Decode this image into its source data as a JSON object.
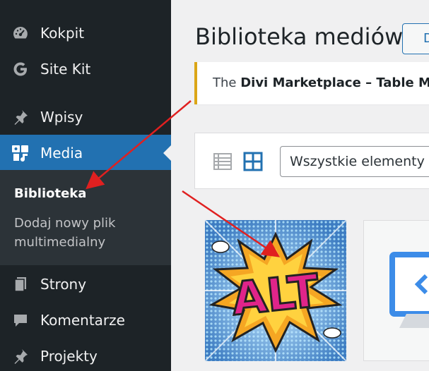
{
  "sidebar": {
    "items": [
      {
        "label": "Kokpit",
        "icon": "dashboard-icon"
      },
      {
        "label": "Site Kit",
        "icon": "google-g-icon"
      },
      {
        "label": "Wpisy",
        "icon": "pushpin-icon"
      },
      {
        "label": "Media",
        "icon": "media-icon",
        "active": true
      },
      {
        "label": "Strony",
        "icon": "pages-icon"
      },
      {
        "label": "Komentarze",
        "icon": "comment-icon"
      },
      {
        "label": "Projekty",
        "icon": "pushpin-icon"
      }
    ],
    "submenu": [
      {
        "label": "Biblioteka",
        "current": true
      },
      {
        "label": "Dodaj nowy plik multimedialny"
      }
    ]
  },
  "main": {
    "title": "Biblioteka mediów",
    "add_new_label": "Do",
    "notice": {
      "prefix": "The ",
      "bold": "Divi Marketplace – Table Make"
    },
    "toolbar": {
      "filter_value": "Wszystkie elementy m"
    },
    "attachments": [
      {
        "text": "ALT",
        "kind": "comic-burst-image"
      },
      {
        "kind": "code-file-thumbnail"
      }
    ]
  },
  "colors": {
    "sidebar_bg": "#1d2327",
    "submenu_bg": "#2c3338",
    "accent": "#2271b1",
    "notice_border": "#dba617",
    "annotation_arrow": "#e02020"
  }
}
